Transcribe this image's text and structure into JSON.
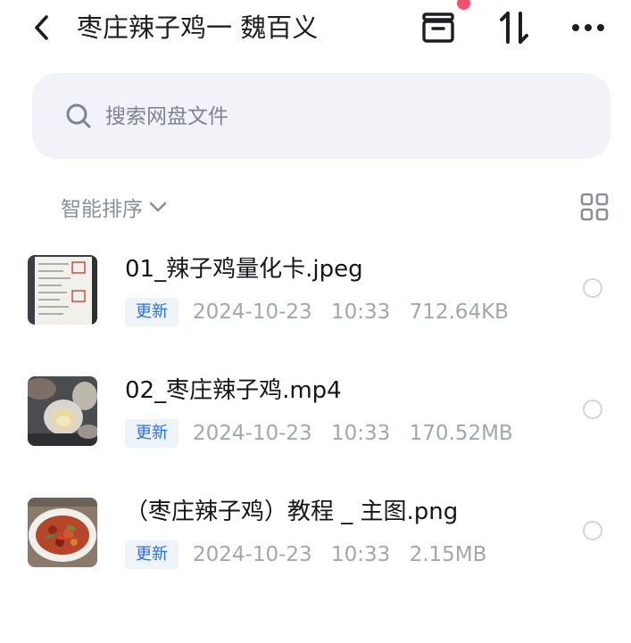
{
  "header": {
    "title": "枣庄辣子鸡一 魏百义",
    "back_icon": "chevron-left-icon",
    "archive_icon": "archive-box-icon",
    "sort_icon": "sort-arrows-icon",
    "more_icon": "more-dots-icon",
    "notification_dot_color": "#f7506e"
  },
  "search": {
    "placeholder": "搜索网盘文件",
    "value": ""
  },
  "toolbar": {
    "sort_label": "智能排序",
    "grid_icon": "grid-view-icon"
  },
  "files": [
    {
      "name": "01_辣子鸡量化卡.jpeg",
      "badge": "更新",
      "date": "2024-10-23",
      "time": "10:33",
      "size": "712.64KB"
    },
    {
      "name": "02_枣庄辣子鸡.mp4",
      "badge": "更新",
      "date": "2024-10-23",
      "time": "10:33",
      "size": "170.52MB"
    },
    {
      "name": "（枣庄辣子鸡）教程 _ 主图.png",
      "badge": "更新",
      "date": "2024-10-23",
      "time": "10:33",
      "size": "2.15MB"
    }
  ],
  "colors": {
    "accent": "#2a6ee8",
    "badge_bg": "#eef4fb",
    "search_bg": "#f1f3f8",
    "muted_text": "#a3a6ae"
  }
}
